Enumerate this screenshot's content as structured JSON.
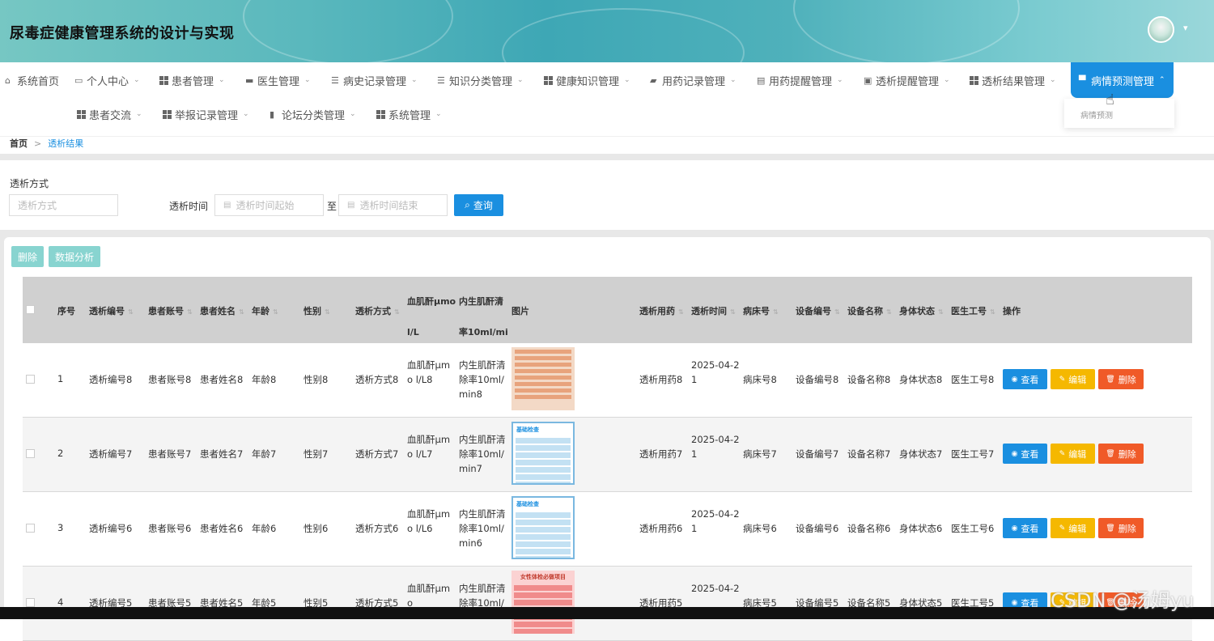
{
  "header": {
    "title": "尿毒症健康管理系统的设计与实现"
  },
  "nav": {
    "row1": [
      {
        "label": "系统首页",
        "icon": "home-icon",
        "caret": false
      },
      {
        "label": "个人中心",
        "icon": "card-icon",
        "caret": true
      },
      {
        "label": "患者管理",
        "icon": "grid-icon",
        "caret": true
      },
      {
        "label": "医生管理",
        "icon": "briefcase-icon",
        "caret": true
      },
      {
        "label": "病史记录管理",
        "icon": "list-icon",
        "caret": true
      },
      {
        "label": "知识分类管理",
        "icon": "list-icon",
        "caret": true
      },
      {
        "label": "健康知识管理",
        "icon": "grid-icon",
        "caret": true
      },
      {
        "label": "用药记录管理",
        "icon": "truck-icon",
        "caret": true
      },
      {
        "label": "用药提醒管理",
        "icon": "clipboard-icon",
        "caret": true
      },
      {
        "label": "透析提醒管理",
        "icon": "calendar-icon",
        "caret": true
      },
      {
        "label": "透析结果管理",
        "icon": "grid-icon",
        "caret": true
      },
      {
        "label": "病情预测管理",
        "icon": "monitor-icon",
        "caret": true
      }
    ],
    "row2": [
      {
        "label": "患者交流",
        "icon": "grid-icon",
        "caret": true
      },
      {
        "label": "举报记录管理",
        "icon": "grid-icon",
        "caret": true
      },
      {
        "label": "论坛分类管理",
        "icon": "flask-icon",
        "caret": true
      },
      {
        "label": "系统管理",
        "icon": "grid-icon",
        "caret": true
      }
    ],
    "dropdown_item": "病情预测"
  },
  "breadcrumb": {
    "home": "首页",
    "sep": ">",
    "current": "透析结果"
  },
  "search": {
    "method_label": "透析方式",
    "method_placeholder": "透析方式",
    "time_label": "透析时间",
    "start_placeholder": "透析时间起始",
    "to": "至",
    "end_placeholder": "透析时间结束",
    "query_label": "查询"
  },
  "toolbar": {
    "delete_label": "删除",
    "analysis_label": "数据分析"
  },
  "table": {
    "headers": {
      "index": "序号",
      "code": "透析编号",
      "account": "患者账号",
      "name": "患者姓名",
      "age": "年龄",
      "gender": "性别",
      "method": "透析方式",
      "scr": "血肌酐μmo l/L",
      "ccr": "内生肌酐清 率10ml/mi",
      "image": "图片",
      "drug": "透析用药",
      "time": "透析时间",
      "bed": "病床号",
      "device_code": "设备编号",
      "device_name": "设备名称",
      "status": "身体状态",
      "doctor": "医生工号",
      "ops": "操作"
    },
    "actions": {
      "view": "查看",
      "edit": "编辑",
      "delete": "删除"
    },
    "rows": [
      {
        "index": "1",
        "code": "透析编号8",
        "account": "患者账号8",
        "name": "患者姓名8",
        "age": "年龄8",
        "gender": "性别8",
        "method": "透析方式8",
        "scr": "血肌酐μmo l/L8",
        "ccr": "内生肌酐清 除率10ml/ min8",
        "drug": "透析用药8",
        "time": "2025-04-2 1",
        "bed": "病床号8",
        "device_code": "设备编号8",
        "device_name": "设备名称8",
        "status": "身体状态8",
        "doctor": "医生工号8",
        "thumb": "orange"
      },
      {
        "index": "2",
        "code": "透析编号7",
        "account": "患者账号7",
        "name": "患者姓名7",
        "age": "年龄7",
        "gender": "性别7",
        "method": "透析方式7",
        "scr": "血肌酐μmo l/L7",
        "ccr": "内生肌酐清 除率10ml/ min7",
        "drug": "透析用药7",
        "time": "2025-04-2 1",
        "bed": "病床号7",
        "device_code": "设备编号7",
        "device_name": "设备名称7",
        "status": "身体状态7",
        "doctor": "医生工号7",
        "thumb": "blue"
      },
      {
        "index": "3",
        "code": "透析编号6",
        "account": "患者账号6",
        "name": "患者姓名6",
        "age": "年龄6",
        "gender": "性别6",
        "method": "透析方式6",
        "scr": "血肌酐μmo l/L6",
        "ccr": "内生肌酐清 除率10ml/ min6",
        "drug": "透析用药6",
        "time": "2025-04-2 1",
        "bed": "病床号6",
        "device_code": "设备编号6",
        "device_name": "设备名称6",
        "status": "身体状态6",
        "doctor": "医生工号6",
        "thumb": "blue"
      },
      {
        "index": "4",
        "code": "透析编号5",
        "account": "患者账号5",
        "name": "患者姓名5",
        "age": "年龄5",
        "gender": "性别5",
        "method": "透析方式5",
        "scr": "血肌酐μmo",
        "ccr": "内生肌酐清 除率10ml/",
        "drug": "透析用药5",
        "time": "2025-04-2",
        "bed": "病床号5",
        "device_code": "设备编号5",
        "device_name": "设备名称5",
        "status": "身体状态5",
        "doctor": "医生工号5",
        "thumb": "pink"
      }
    ]
  },
  "thumb_texts": {
    "blue": "基础检查",
    "pink": "女性体检必做项目"
  },
  "watermark": "CSDN @汤姆yu",
  "colors": {
    "primary": "#1a8fe0",
    "edit": "#f5b800",
    "delete": "#f05a28",
    "toolbar": "#88d4d0"
  }
}
